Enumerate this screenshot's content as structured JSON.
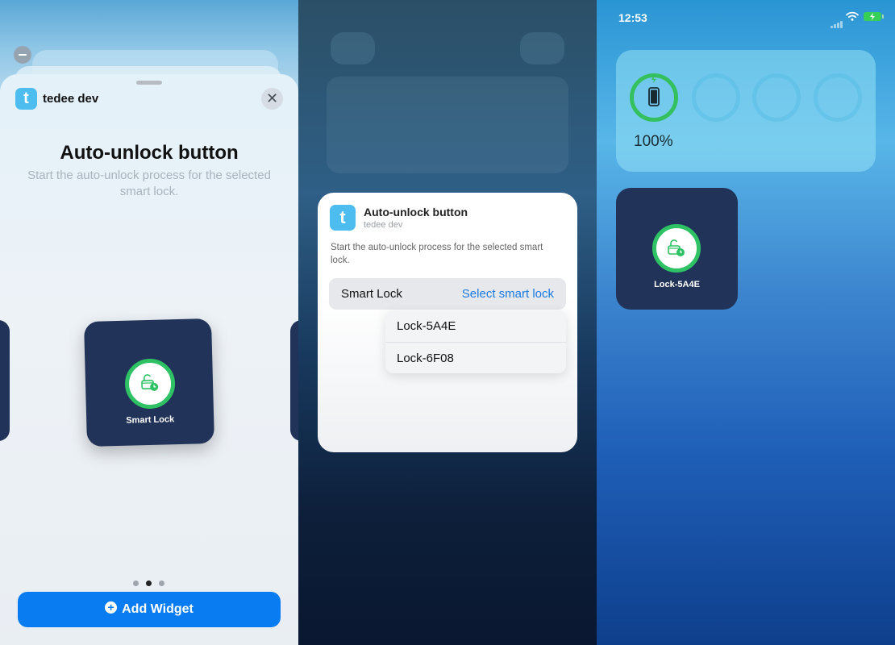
{
  "panel1": {
    "app_icon_letter": "t",
    "app_name": "tedee dev",
    "close_glyph": "✕",
    "title": "Auto-unlock button",
    "description": "Start the auto-unlock process for the selected smart lock.",
    "widget_label": "Smart Lock",
    "page_dots": {
      "count": 3,
      "active_index": 1
    },
    "add_button_label": "Add Widget",
    "add_button_icon": "plus-circle-icon"
  },
  "panel2": {
    "app_icon_letter": "t",
    "title": "Auto-unlock button",
    "subtitle": "tedee dev",
    "description": "Start the auto-unlock process for the selected smart lock.",
    "param_label": "Smart Lock",
    "param_value": "Select smart lock",
    "options": [
      "Lock-5A4E",
      "Lock-6F08"
    ]
  },
  "panel3": {
    "status_time": "12:53",
    "battery_percent": "100%",
    "widget_label": "Lock-5A4E"
  },
  "colors": {
    "accent_blue": "#0a7cf2",
    "link_blue": "#1a7ae0",
    "widget_navy": "#213358",
    "lock_green": "#2ec264",
    "app_icon": "#4dbdf0"
  }
}
